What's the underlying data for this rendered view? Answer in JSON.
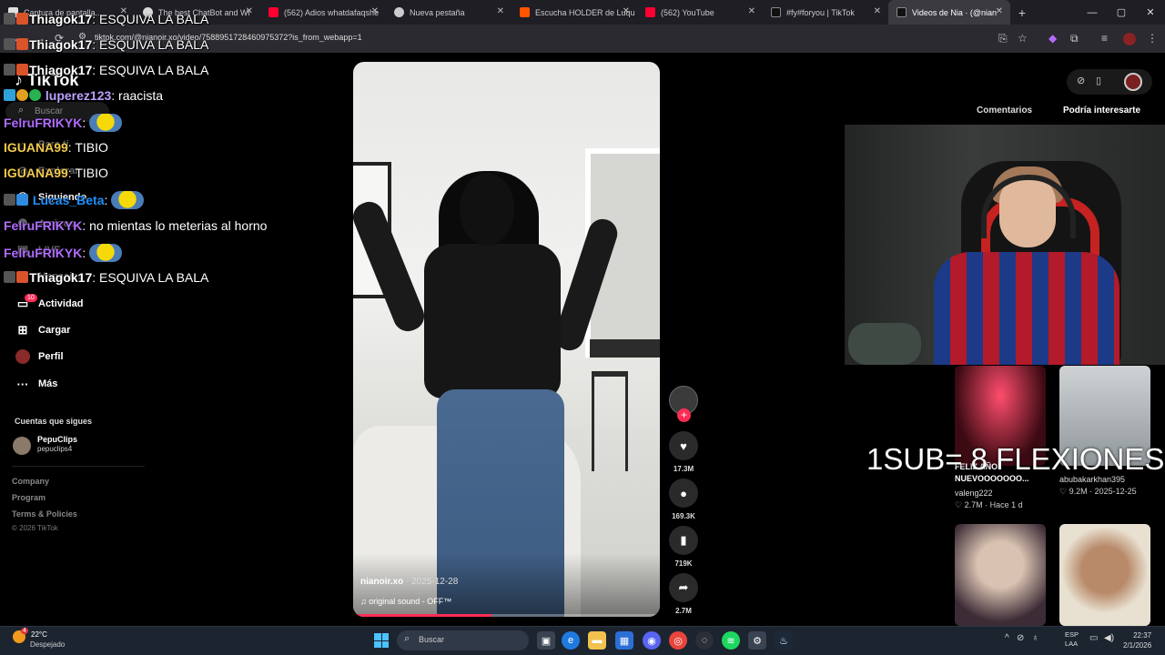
{
  "browser": {
    "tabs": [
      {
        "title": "Captura de pantalla...",
        "color": "#e0e0e0"
      },
      {
        "title": "The best ChatBot and Wi",
        "color": "#d8d8d8"
      },
      {
        "title": "(562) Adios whatdafaqshe",
        "color": "#ff0033"
      },
      {
        "title": "Nueva pestaña",
        "color": "#cccccc"
      },
      {
        "title": "Escucha HOLDER de Luqu",
        "color": "#ff5500"
      },
      {
        "title": "(562) YouTube",
        "color": "#ff0033"
      },
      {
        "title": "#fy#foryou | TikTok",
        "color": "#ffffff"
      },
      {
        "title": "Videos de Nia · (@nian",
        "color": "#ffffff",
        "active": true
      }
    ],
    "url": "tiktok.com/@nianoir.xo/video/7588951728460975372?is_from_webapp=1",
    "new_tab": "+",
    "window": {
      "minimize": "—",
      "maximize": "▢",
      "close": "✕"
    }
  },
  "sidebar": {
    "logo": "TikTok",
    "search_placeholder": "Buscar",
    "items": [
      {
        "label": "Para ti",
        "icon": "home-icon"
      },
      {
        "label": "Explorar",
        "icon": "compass-icon"
      },
      {
        "label": "Siguiendo",
        "icon": "following-icon"
      },
      {
        "label": "Amigos",
        "icon": "friends-icon"
      },
      {
        "label": "LIVE",
        "icon": "live-icon"
      },
      {
        "label": "Mensajes",
        "icon": "messages-icon"
      },
      {
        "label": "Actividad",
        "icon": "activity-icon",
        "badge": "10"
      },
      {
        "label": "Cargar",
        "icon": "upload-icon"
      },
      {
        "label": "Perfil",
        "icon": "profile-icon"
      },
      {
        "label": "Más",
        "icon": "more-icon"
      }
    ],
    "following_title": "Cuentas que sigues",
    "following": [
      {
        "name": "PepuClips",
        "handle": "pepuclips4"
      }
    ],
    "footer": [
      "Company",
      "Program",
      "Terms & Policies"
    ],
    "copyright": "© 2026 TikTok"
  },
  "chat": [
    {
      "user": "Thiagok17",
      "color": "#ffffff",
      "message": ": ESQUIVA LA BALA"
    },
    {
      "user": "Thiagok17",
      "color": "#ffffff",
      "message": ": ESQUIVA LA BALA"
    },
    {
      "user": "Thiagok17",
      "color": "#ffffff",
      "message": ": ESQUIVA LA BALA"
    },
    {
      "user": "luperez123",
      "color": "#b9a2ff",
      "message": ": raacista"
    },
    {
      "user": "FelruFRIKYK",
      "color": "#b06cff",
      "message": ":",
      "emote": true
    },
    {
      "user": "IGUANA99",
      "color": "#f2c94c",
      "message": ": TIBIO"
    },
    {
      "user": "IGUANA99",
      "color": "#f2c94c",
      "message": ": TIBIO"
    },
    {
      "user": "Lucas_Beta",
      "color": "#1e90ff",
      "message": ":",
      "emote": true
    },
    {
      "user": "FelruFRIKYK",
      "color": "#b06cff",
      "message": ": no mientas lo meterias al horno"
    },
    {
      "user": "FelruFRIKYK",
      "color": "#b06cff",
      "message": ":",
      "emote": true
    },
    {
      "user": "Thiagok17",
      "color": "#ffffff",
      "message": ": ESQUIVA LA BALA"
    }
  ],
  "video": {
    "author": "nianoir.xo",
    "date": "· 2025-12-28",
    "sound": "♫ original sound - OFF™",
    "progress": 0.45
  },
  "actions": {
    "likes": "17.3M",
    "comments": "169.3K",
    "saves": "719K",
    "shares": "2.7M",
    "follow": "+"
  },
  "right_panel": {
    "tabs": [
      "Comentarios",
      "Podría interesarte"
    ],
    "overlay_text": "1SUB= 8 FLEXIONES",
    "suggestions": [
      {
        "caption": "FELIZ AÑO NUEVOOOOOOO...",
        "user": "valeng222",
        "likes": "♡ 2.7M",
        "date": "· Hace 1 d"
      },
      {
        "caption": "",
        "user": "abubakarkhan395",
        "likes": "♡ 9.2M",
        "date": "· 2025-12-25"
      }
    ]
  },
  "taskbar": {
    "temperature": "22°C",
    "condition": "Despejado",
    "weather_badge": "4",
    "search_placeholder": "Buscar",
    "lang": "ESP",
    "lang2": "LAA",
    "time": "22:37",
    "date": "2/1/2026"
  },
  "colors": {
    "accent": "#fe2c55",
    "taskbar": "#1c2430"
  }
}
